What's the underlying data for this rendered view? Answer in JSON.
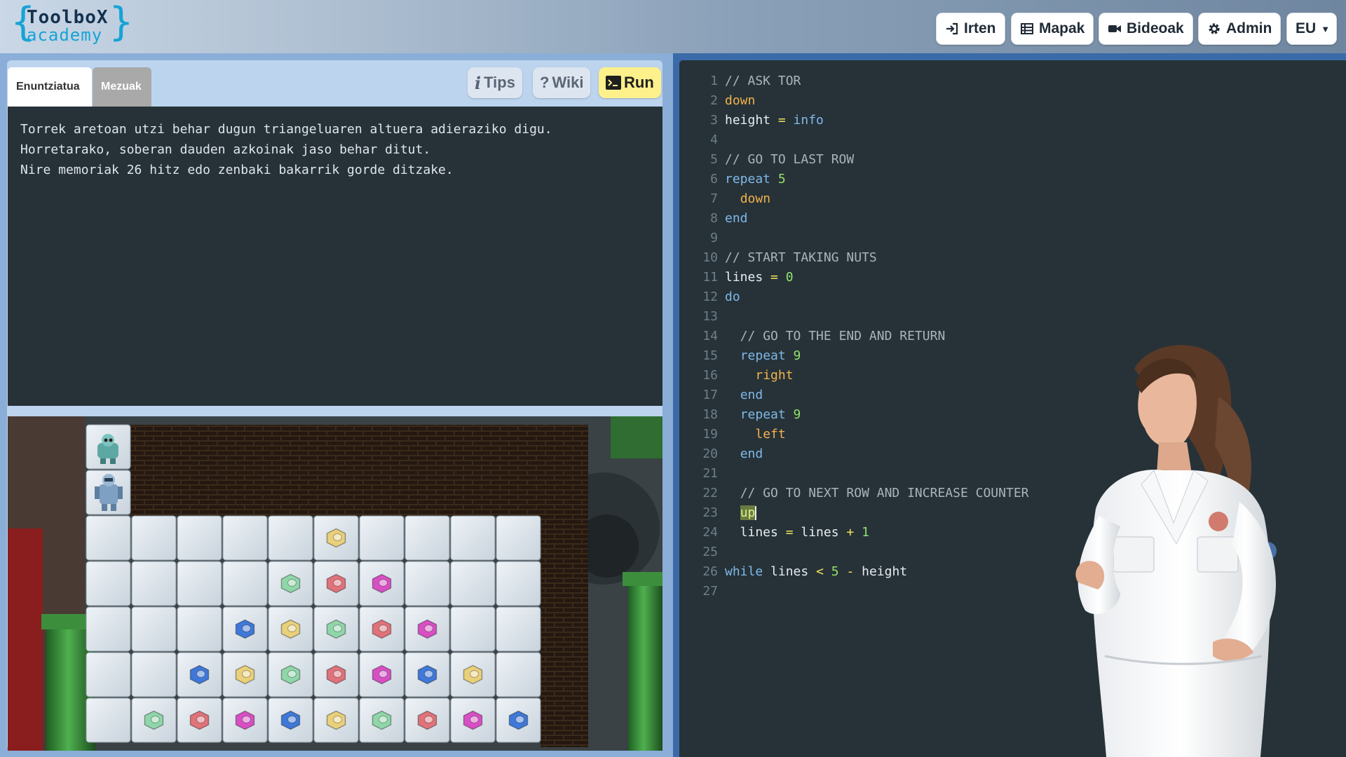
{
  "header": {
    "logo_line1": "ToolboX",
    "logo_line2": "academy",
    "nav": [
      {
        "label": "Irten",
        "icon": "sign-out-icon"
      },
      {
        "label": "Mapak",
        "icon": "table-icon"
      },
      {
        "label": "Bideoak",
        "icon": "video-camera-icon"
      },
      {
        "label": "Admin",
        "icon": "gear-icon"
      }
    ],
    "language": "EU"
  },
  "left": {
    "tabs": [
      {
        "label": "Enuntziatua",
        "active": true
      },
      {
        "label": "Mezuak",
        "active": false
      }
    ],
    "tools": [
      {
        "label": "Tips",
        "icon": "info-icon"
      },
      {
        "label": "Wiki",
        "icon": "question-icon"
      },
      {
        "label": "Run",
        "icon": "terminal-icon"
      }
    ],
    "statement": [
      "Torrek aretoan utzi behar dugun triangeluaren altuera adieraziko digu.",
      "Horretarako, soberan dauden azkoinak jaso behar ditut.",
      "",
      "Nire memoriak 26 hitz edo zenbaki bakarrik gorde ditzake."
    ]
  },
  "game": {
    "nut_colors": {
      "gold": "#e9d07a",
      "green": "#8fd6a8",
      "red": "#e0727a",
      "magenta": "#d84fc4",
      "blue": "#3f78d8"
    },
    "nut_rows": [
      [
        "",
        "",
        "",
        "",
        "",
        "gold",
        "",
        "",
        "",
        ""
      ],
      [
        "",
        "",
        "",
        "",
        "green",
        "red",
        "magenta",
        "",
        "",
        ""
      ],
      [
        "",
        "",
        "",
        "blue",
        "gold",
        "green",
        "red",
        "magenta",
        "",
        ""
      ],
      [
        "",
        "",
        "blue",
        "gold",
        "green",
        "red",
        "magenta",
        "blue",
        "gold",
        ""
      ],
      [
        "",
        "green",
        "red",
        "magenta",
        "blue",
        "gold",
        "green",
        "red",
        "magenta",
        "blue"
      ]
    ]
  },
  "editor": {
    "lines": [
      [
        [
          "comment",
          "// ASK TOR"
        ]
      ],
      [
        [
          "cmd",
          "down"
        ]
      ],
      [
        [
          "var",
          "height "
        ],
        [
          "op",
          "="
        ],
        [
          "var",
          " "
        ],
        [
          "kw",
          "info"
        ]
      ],
      [],
      [
        [
          "comment",
          "// GO TO LAST ROW"
        ]
      ],
      [
        [
          "kw",
          "repeat "
        ],
        [
          "num",
          "5"
        ]
      ],
      [
        [
          "var",
          "  "
        ],
        [
          "cmd",
          "down"
        ]
      ],
      [
        [
          "kw",
          "end"
        ]
      ],
      [],
      [
        [
          "comment",
          "// START TAKING NUTS"
        ]
      ],
      [
        [
          "var",
          "lines "
        ],
        [
          "op",
          "="
        ],
        [
          "var",
          " "
        ],
        [
          "num",
          "0"
        ]
      ],
      [
        [
          "kw",
          "do"
        ]
      ],
      [],
      [
        [
          "var",
          "  "
        ],
        [
          "comment",
          "// GO TO THE END AND RETURN"
        ]
      ],
      [
        [
          "var",
          "  "
        ],
        [
          "kw",
          "repeat "
        ],
        [
          "num",
          "9"
        ]
      ],
      [
        [
          "var",
          "    "
        ],
        [
          "cmd",
          "right"
        ]
      ],
      [
        [
          "var",
          "  "
        ],
        [
          "kw",
          "end"
        ]
      ],
      [
        [
          "var",
          "  "
        ],
        [
          "kw",
          "repeat "
        ],
        [
          "num",
          "9"
        ]
      ],
      [
        [
          "var",
          "    "
        ],
        [
          "cmd",
          "left"
        ]
      ],
      [
        [
          "var",
          "  "
        ],
        [
          "kw",
          "end"
        ]
      ],
      [],
      [
        [
          "var",
          "  "
        ],
        [
          "comment",
          "// GO TO NEXT ROW AND INCREASE COUNTER"
        ]
      ],
      [
        [
          "var",
          "  "
        ],
        [
          "cursor",
          "up"
        ]
      ],
      [
        [
          "var",
          "  lines "
        ],
        [
          "op",
          "="
        ],
        [
          "var",
          " lines "
        ],
        [
          "op",
          "+"
        ],
        [
          "var",
          " "
        ],
        [
          "num",
          "1"
        ]
      ],
      [],
      [
        [
          "kw",
          "while "
        ],
        [
          "var",
          "lines "
        ],
        [
          "op",
          "<"
        ],
        [
          "var",
          " "
        ],
        [
          "num",
          "5"
        ],
        [
          "var",
          " "
        ],
        [
          "op",
          "-"
        ],
        [
          "var",
          " height"
        ]
      ],
      []
    ]
  }
}
